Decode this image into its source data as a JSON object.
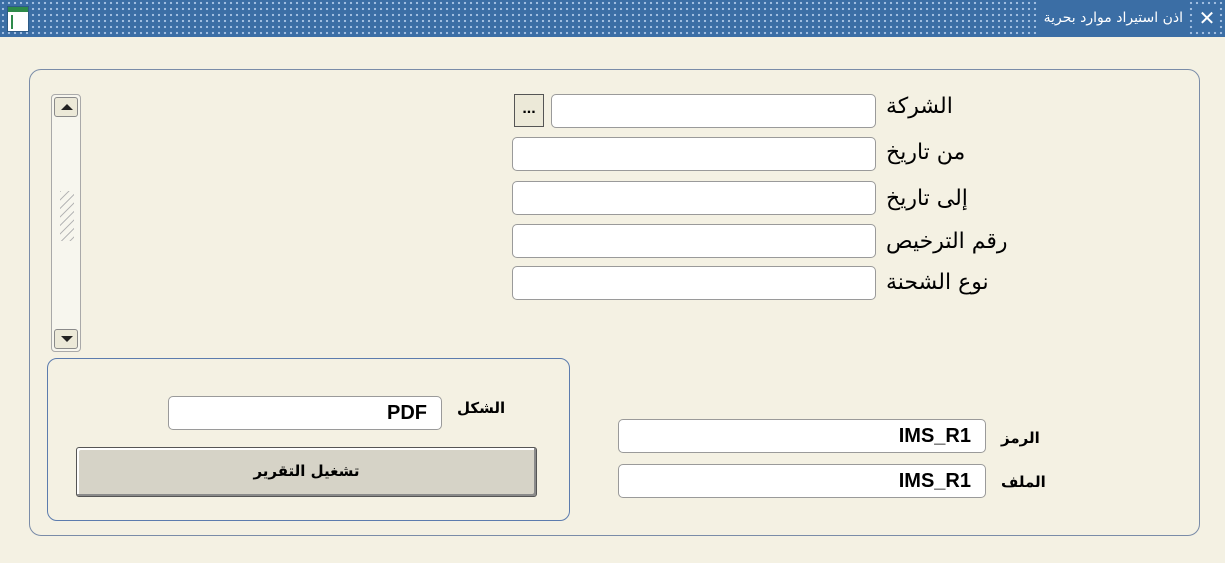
{
  "window": {
    "title": "اذن استيراد موارد بحرية",
    "close_glyph": "✕ ⟝"
  },
  "criteria": {
    "company": {
      "label": "الشركة",
      "value": ""
    },
    "lov_button_label": "...",
    "from_date": {
      "label": "من تاريخ",
      "value": ""
    },
    "to_date": {
      "label": "إلى تاريخ",
      "value": ""
    },
    "license_no": {
      "label": "رقم الترخيص",
      "value": ""
    },
    "shipment_type": {
      "label": "نوع الشحنة",
      "value": ""
    }
  },
  "report": {
    "format": {
      "label": "الشكل",
      "value": "PDF"
    },
    "run_button_label": "تشغيل التقرير"
  },
  "meta": {
    "code": {
      "label": "الرمز",
      "value": "IMS_R1"
    },
    "file": {
      "label": "الملف",
      "value": "IMS_R1"
    }
  },
  "icons": [
    "close-icon",
    "document-icon",
    "scroll-up-icon",
    "scroll-down-icon"
  ],
  "colors": {
    "title_bar": "#3b6ea5",
    "background": "#f4f1e3",
    "panel_border": "#7a8ca8"
  }
}
